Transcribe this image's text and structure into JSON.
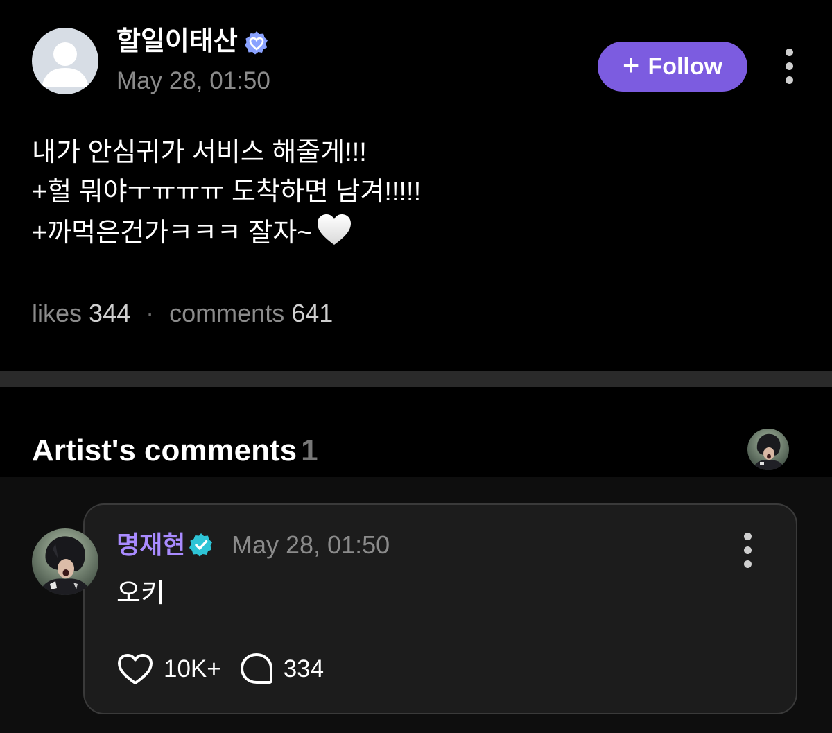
{
  "post": {
    "author": "할일이태산",
    "timestamp": "May 28, 01:50",
    "follow_label": "Follow",
    "follow_icon": "plus-icon",
    "lines": [
      "내가 안심귀가 서비스 해줄게!!!",
      "+헐 뭐야ㅜㅠㅠㅠ 도착하면 남겨!!!!!",
      "+까먹은건가ㅋㅋㅋ 잘자~"
    ],
    "end_emoji": "white-heart-icon",
    "stats": {
      "likes_label": "likes",
      "likes_value": "344",
      "separator": "·",
      "comments_label": "comments",
      "comments_value": "641"
    }
  },
  "artist_comments": {
    "title": "Artist's comments",
    "count": "1"
  },
  "comment": {
    "author": "명재현",
    "timestamp": "May 28, 01:50",
    "text": "오키",
    "likes": "10K+",
    "replies": "334"
  },
  "colors": {
    "background": "#000000",
    "accent": "#7c5ce0",
    "artist_name": "#a98bff",
    "verified_teal": "#2ec4d6",
    "muted_text": "#8b8b8b"
  }
}
